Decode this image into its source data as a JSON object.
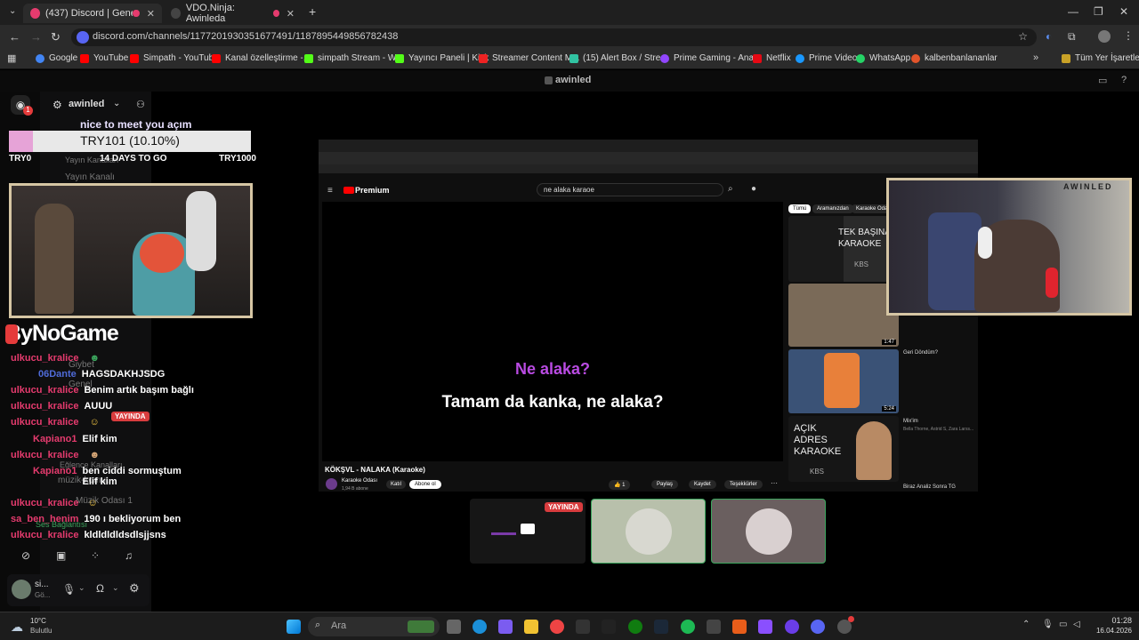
{
  "browser": {
    "tabs": [
      {
        "label": "(437) Discord | Genel Sohbet",
        "active": true
      },
      {
        "label": "VDO.Ninja: Awinleda",
        "active": false
      }
    ],
    "url": "discord.com/channels/1177201930351677491/1187895449856782438",
    "bookmarks": [
      "Google",
      "YouTube",
      "Simpath - YouTube",
      "Kanal özelleştirme -...",
      "simpath Stream - W...",
      "Yayıncı Paneli | Kick",
      "Streamer Content M...",
      "(15) Alert Box / Stre...",
      "Prime Gaming - Ana...",
      "Netflix",
      "Prime Video",
      "WhatsApp",
      "kalbenbanlananlar"
    ],
    "all_bookmarks": "Tüm Yer İşaretleri"
  },
  "discord": {
    "stage_title": "awinled",
    "server_name": "awinled",
    "channel_texts": [
      "Yayın Kanalları",
      "Yayın Kanalı",
      "Giybet",
      "Genel",
      "Eğlence Kanalları",
      "müzik-komut",
      "Müzik Odası 1",
      "Ses Bağlantısı"
    ],
    "live_badge": "YAYINDA",
    "user_short": "si...",
    "user_status": "Gö..."
  },
  "overlay": {
    "greeting": "nice to meet you açım",
    "donation_text": "TRY101 (10.10%)",
    "donation_fraction": 0.101,
    "goal_left": "TRY0",
    "goal_days": "14 DAYS TO GO",
    "goal_right": "TRY1000",
    "brand": "ByNoGame",
    "cam_label": "AWINLED"
  },
  "chat": [
    {
      "user": "ulkucu_kralice",
      "msg": ""
    },
    {
      "user": "06Dante",
      "msg": "HAGSDAKHJSDG"
    },
    {
      "user": "ulkucu_kralice",
      "msg": "Benim artık başım bağlı"
    },
    {
      "user": "ulkucu_kralice",
      "msg": "AUUU"
    },
    {
      "user": "ulkucu_kralice",
      "msg": ""
    },
    {
      "user": "Kapiano1",
      "msg": "Elif kim"
    },
    {
      "user": "ulkucu_kralice",
      "msg": ""
    },
    {
      "user": "Kapiano1",
      "msg": "ben ciddi sormuştum Elif kim"
    },
    {
      "user": "ulkucu_kralice",
      "msg": ""
    },
    {
      "user": "sa_ben_henim",
      "msg": "190 ı bekliyorum ben"
    },
    {
      "user": "ulkucu_kralice",
      "msg": "kldldldldsdlsjjsns"
    }
  ],
  "youtube": {
    "search": "ne alaka karaoe",
    "premium": "Premium",
    "lyric_line1": "Ne alaka?",
    "lyric_line2": "Tamam da kanka, ne alaka?",
    "video_title": "KÖKŞVL - NALAKA (Karaoke)",
    "channel": "Karaoke Odası",
    "subscribers": "1,94 B abone",
    "join": "Katıl",
    "subscribe": "Abone ol",
    "likes": "1",
    "share": "Paylaş",
    "save": "Kaydet",
    "thanks": "Teşekkürler",
    "filters": [
      "Tümü",
      "Aramanızdan",
      "Karaoke Odası"
    ],
    "sidebar_items": [
      {
        "title": "TEK BAŞINA KARAOKE",
        "meta": "KBS"
      },
      {
        "title": "Geri Döndüm?",
        "meta": "",
        "duration": "1:47"
      },
      {
        "title": "",
        "meta": "",
        "duration": "5:24"
      },
      {
        "title": "Mix'im",
        "meta": "Bella Thorne, Astrid S, Zara Larss..."
      },
      {
        "title": "AÇIK ADRES KARAOKE",
        "meta": "KBS"
      },
      {
        "title": "Biraz Analiz Sonra TG",
        "meta": ""
      }
    ]
  },
  "taskbar": {
    "weather_temp": "10°C",
    "weather_desc": "Bulutlu",
    "search_placeholder": "Ara",
    "time": "01:28",
    "date": "16.04.2026"
  },
  "colors": {
    "discord_blurple": "#5865f2",
    "chat_user": "#e53b6e",
    "lyric_highlight": "#b94be2",
    "donation_fill": "#e6a3d7",
    "live_red": "#d83c3e"
  }
}
